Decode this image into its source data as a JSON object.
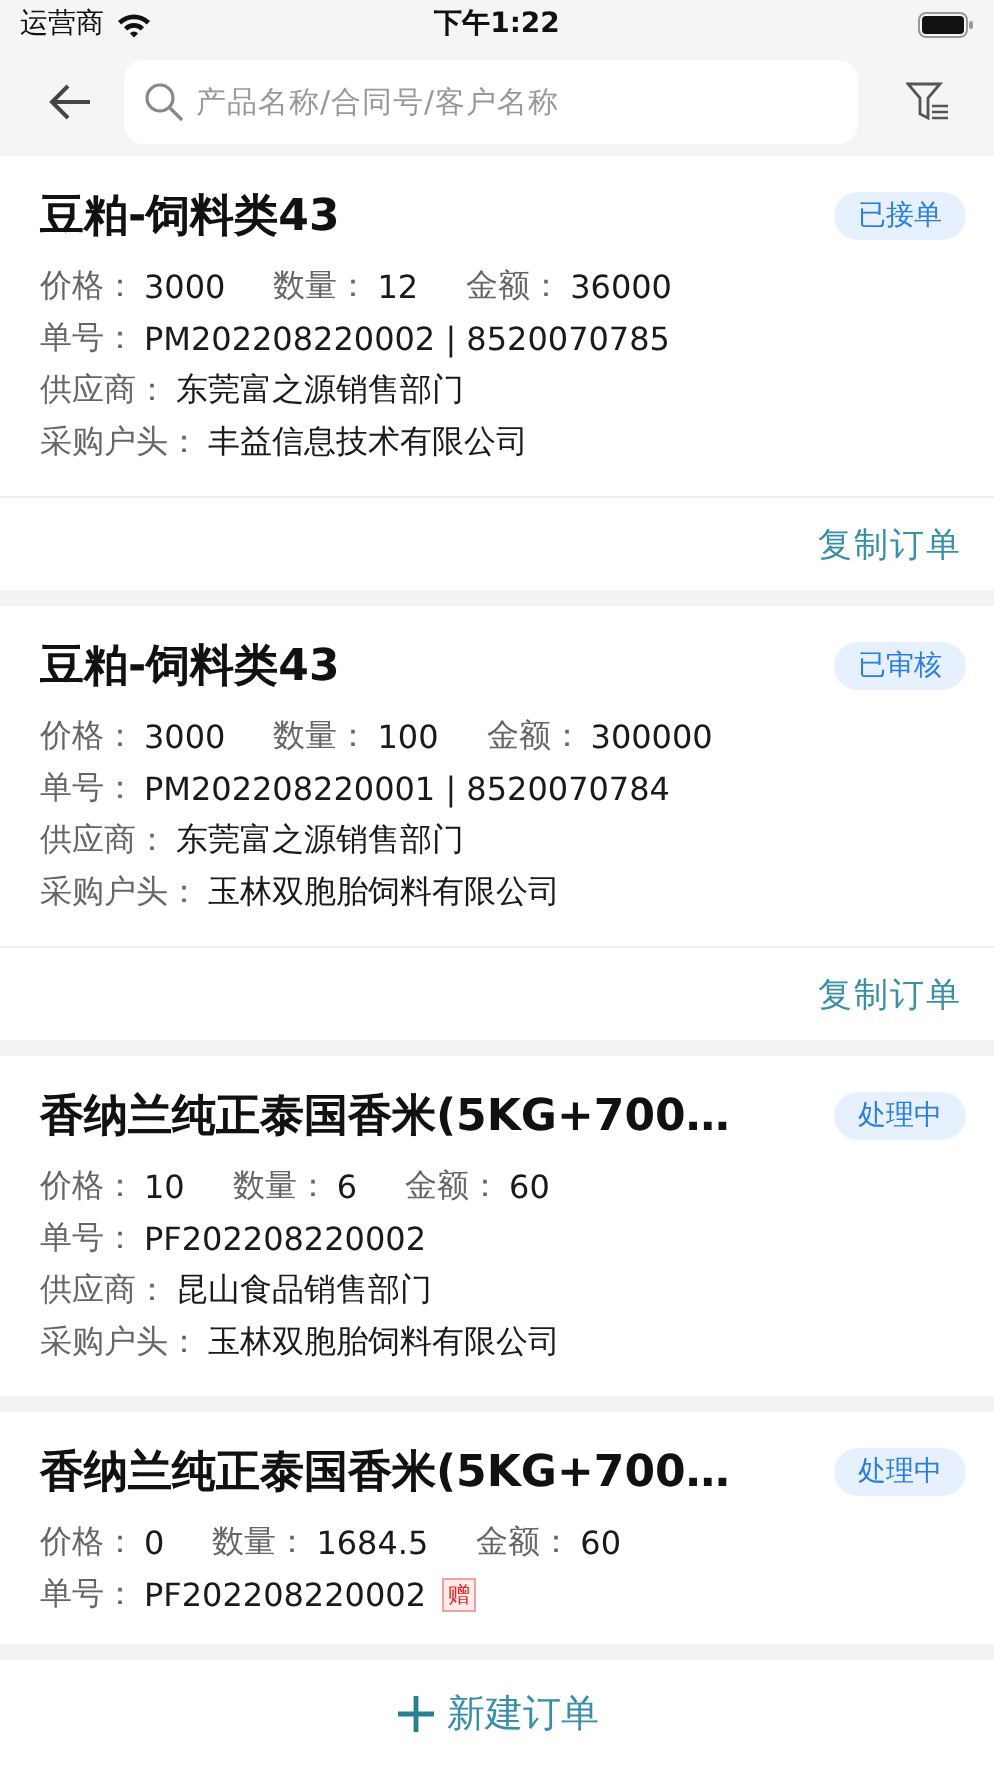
{
  "status_bar": {
    "carrier": "运营商",
    "time": "下午1:22"
  },
  "search": {
    "placeholder": "产品名称/合同号/客户名称"
  },
  "orders": [
    {
      "title": "豆粕-饲料类43",
      "status": "已接单",
      "lines": [
        [
          {
            "label": "价格：",
            "value": "3000"
          },
          {
            "label": "数量：",
            "value": "12"
          },
          {
            "label": "金额：",
            "value": "36000"
          }
        ],
        [
          {
            "label": "单号：",
            "value": "PM202208220002 | 8520070785"
          }
        ],
        [
          {
            "label": "供应商：",
            "value": "东莞富之源销售部门"
          }
        ],
        [
          {
            "label": "采购户头：",
            "value": "丰益信息技术有限公司"
          }
        ]
      ],
      "actions": [
        "复制订单"
      ]
    },
    {
      "title": "豆粕-饲料类43",
      "status": "已审核",
      "lines": [
        [
          {
            "label": "价格：",
            "value": "3000"
          },
          {
            "label": "数量：",
            "value": "100"
          },
          {
            "label": "金额：",
            "value": "300000"
          }
        ],
        [
          {
            "label": "单号：",
            "value": "PM202208220001 | 8520070784"
          }
        ],
        [
          {
            "label": "供应商：",
            "value": "东莞富之源销售部门"
          }
        ],
        [
          {
            "label": "采购户头：",
            "value": "玉林双胞胎饲料有限公司"
          }
        ]
      ],
      "actions": [
        "复制订单"
      ]
    },
    {
      "title": "香纳兰纯正泰国香米(5KG+700…",
      "status": "处理中",
      "lines": [
        [
          {
            "label": "价格：",
            "value": "10"
          },
          {
            "label": "数量：",
            "value": "6"
          },
          {
            "label": "金额：",
            "value": "60"
          }
        ],
        [
          {
            "label": "单号：",
            "value": "PF202208220002"
          }
        ],
        [
          {
            "label": "供应商：",
            "value": "昆山食品销售部门"
          }
        ],
        [
          {
            "label": "采购户头：",
            "value": "玉林双胞胎饲料有限公司"
          }
        ]
      ]
    },
    {
      "title": "香纳兰纯正泰国香米(5KG+700…",
      "status": "处理中",
      "lines": [
        [
          {
            "label": "价格：",
            "value": "0"
          },
          {
            "label": "数量：",
            "value": "1684.5"
          },
          {
            "label": "金额：",
            "value": "60"
          }
        ],
        [
          {
            "label": "单号：",
            "value": "PF202208220002",
            "tag": "赠"
          }
        ]
      ]
    }
  ],
  "bottom_button": "新建订单"
}
